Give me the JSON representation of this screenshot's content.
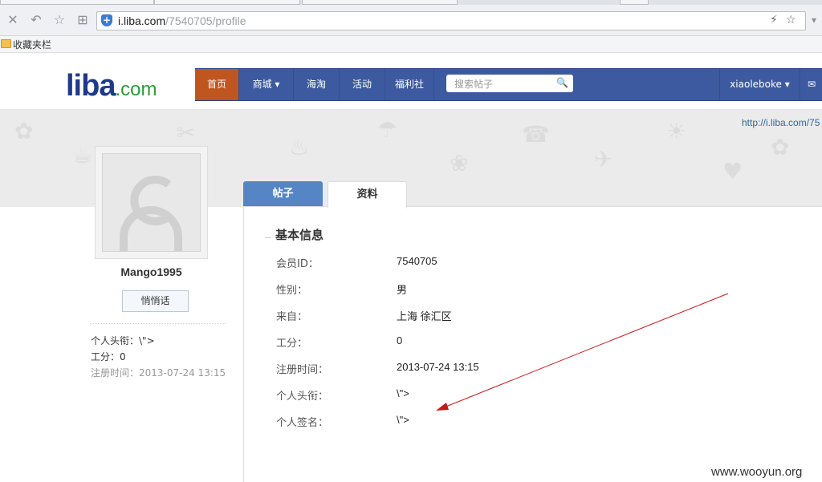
{
  "browser": {
    "url_domain": "i.liba.com",
    "url_path": "/7540705/profile",
    "bookmarks_label": "收藏夹栏"
  },
  "site": {
    "logo_main": "liba",
    "logo_tld": ".com",
    "nav": [
      "首页",
      "商城",
      "海淘",
      "活动",
      "福利社"
    ],
    "search_placeholder": "搜索帖子",
    "username": "xiaoleboke",
    "brand_color": "#3d5aa0",
    "active_color": "#c0561f"
  },
  "banner": {
    "url_text": "http://i.liba.com/75"
  },
  "profile": {
    "name": "Mango1995",
    "message_button": "悄悄话",
    "title_line": "个人头衔：\\\">",
    "score_line": "工分：0",
    "register_line": "注册时间：2013-07-24 13:15"
  },
  "tabs": [
    "帖子",
    "资料"
  ],
  "info": {
    "section_title": "基本信息",
    "rows": [
      {
        "label": "会员ID：",
        "value": "7540705"
      },
      {
        "label": "性别：",
        "value": "男"
      },
      {
        "label": "来自：",
        "value": "上海 徐汇区"
      },
      {
        "label": "工分：",
        "value": "0"
      },
      {
        "label": "注册时间：",
        "value": "2013-07-24 13:15"
      },
      {
        "label": "个人头衔：",
        "value": "\\\">"
      },
      {
        "label": "个人签名：",
        "value": "\\\">"
      }
    ]
  },
  "watermark": "www.wooyun.org"
}
